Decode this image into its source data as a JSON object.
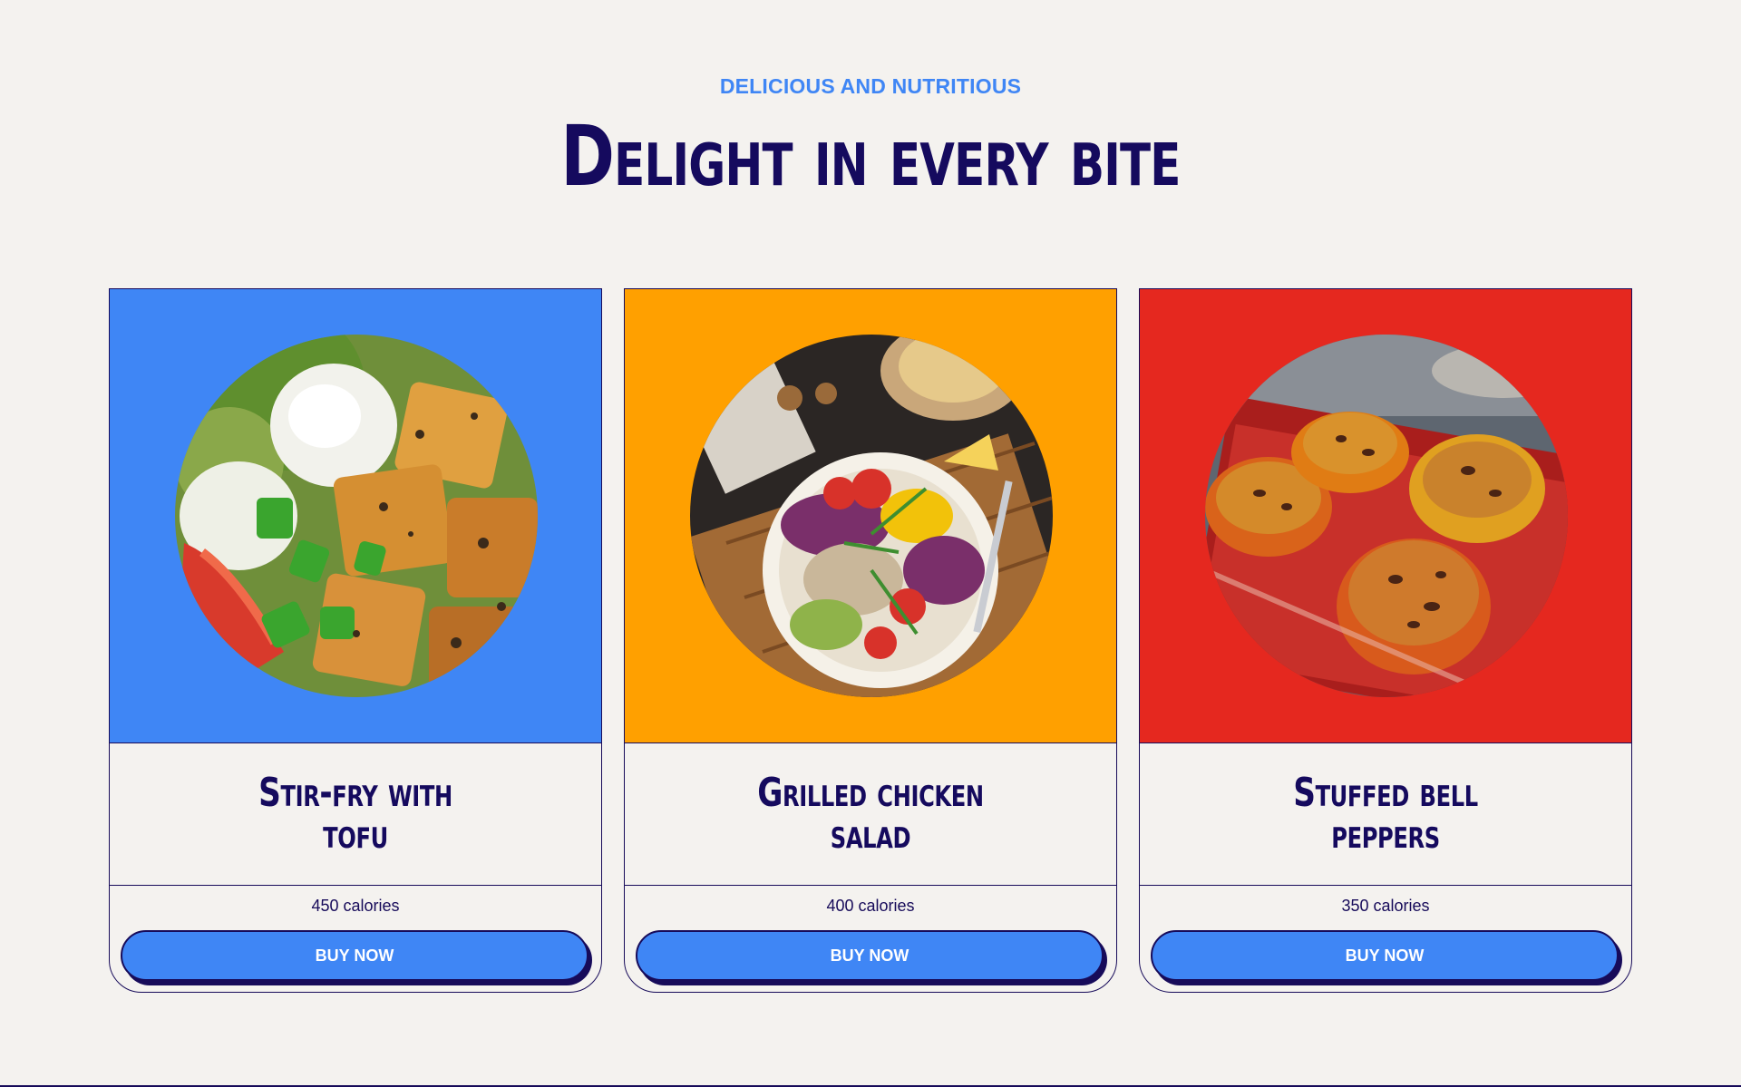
{
  "section": {
    "eyebrow": "DELICIOUS AND NUTRITIOUS",
    "headline": "Delight in every bite"
  },
  "colors": {
    "background": "#f4f2ef",
    "navy": "#150a5e",
    "accent_blue": "#3f86f5",
    "card_blue": "#3f86f5",
    "card_orange": "#ffa000",
    "card_red": "#e5281f"
  },
  "cards": [
    {
      "title": "Stir-fry with tofu",
      "calories": "450 calories",
      "button_label": "BUY NOW",
      "background": "#3f86f5",
      "image": "tofu-bowl-image"
    },
    {
      "title": "Grilled chicken salad",
      "calories": "400 calories",
      "button_label": "BUY NOW",
      "background": "#ffa000",
      "image": "chicken-salad-image"
    },
    {
      "title": "Stuffed bell peppers",
      "calories": "350 calories",
      "button_label": "BUY NOW",
      "background": "#e5281f",
      "image": "stuffed-peppers-image"
    }
  ]
}
